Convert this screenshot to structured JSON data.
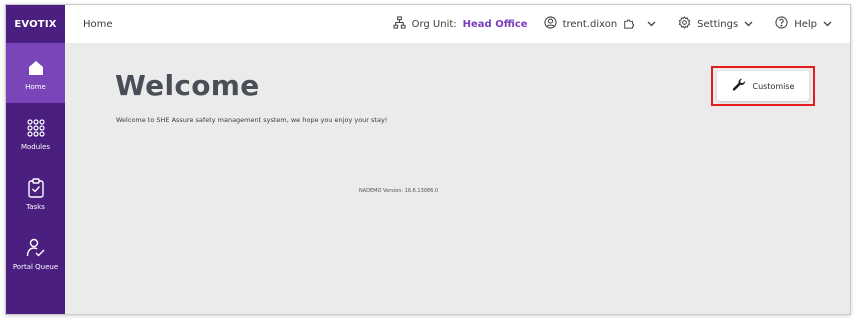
{
  "sidebar": {
    "logo": "EVOTIX",
    "items": [
      {
        "label": "Home",
        "icon": "home-icon"
      },
      {
        "label": "Modules",
        "icon": "modules-grid-icon"
      },
      {
        "label": "Tasks",
        "icon": "clipboard-check-icon"
      },
      {
        "label": "Portal Queue",
        "icon": "portal-queue-icon"
      }
    ]
  },
  "topbar": {
    "breadcrumb": "Home",
    "org_unit_label": "Org Unit:",
    "org_unit_value": "Head Office",
    "user": "trent.dixon",
    "settings": "Settings",
    "help": "Help"
  },
  "main": {
    "title": "Welcome",
    "subtitle": "Welcome to SHE Assure safety management system, we hope you enjoy your stay!",
    "version": "NADEMO Version: 16.6.13086.0",
    "customise_label": "Customise"
  },
  "colors": {
    "sidebar": "#4b1f80",
    "sidebar_active": "#7a45b8",
    "accent": "#7a3fc0",
    "highlight": "#e41e1e",
    "background": "#ebebeb"
  }
}
